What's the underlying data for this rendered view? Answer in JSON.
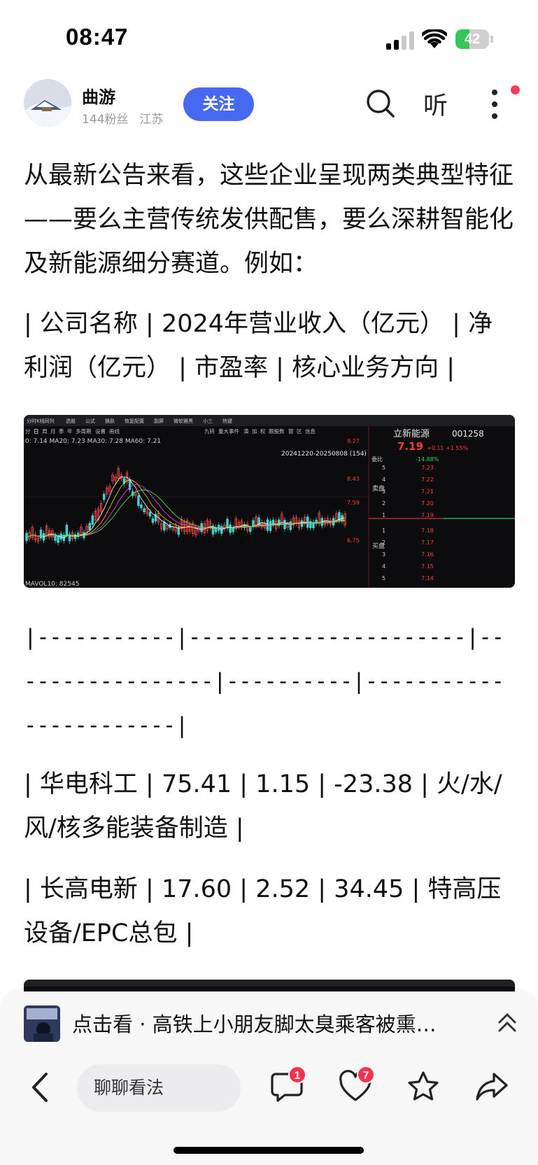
{
  "status_bar": {
    "time": "08:47",
    "battery_level": "42",
    "battery_fill_fraction": 0.42
  },
  "author": {
    "name": "曲游",
    "followers": "144粉丝",
    "location": "江苏",
    "follow_label": "关注",
    "listen_label": "听"
  },
  "article": {
    "paragraphs": [
      "从最新公告来看，这些企业呈现两类典型特征——要么主营传统发供配售，要么深耕智能化及新能源细分赛道。例如：",
      "| 公司名称 | 2024年营业收入（亿元） | 净利润（亿元） | 市盈率 | 核心业务方向 |",
      "|-----------|----------------------|-----------------|----------|-----------------------|",
      "| 华电科工 | 75.41 | 1.15 | -23.38 | 火/水/风/核多能装备制造 |",
      "| 长高电新 | 17.60 | 2.52 | 34.45 | 特高压设备/EPC总包 |"
    ],
    "chart_image": {
      "stock_name": "立新能源",
      "stock_code": "001258",
      "price": "7.19",
      "change": "+0.11",
      "change_pct": "+1.55%",
      "ma_line": "0: 7.14  MA20: 7.23  MA30: 7.28  MA60: 7.21",
      "range_label": "20241220-20250808 (154)",
      "axis_labels": [
        "9.27",
        "8.43",
        "7.59",
        "6.75"
      ],
      "vol_label": "MAVOL10: 82545",
      "order_book_header": "委比",
      "order_book_ratio": "-14.88%",
      "sell_label": "卖盘",
      "buy_label": "买盘",
      "order_rows": [
        {
          "level": "5",
          "price": "7.23"
        },
        {
          "level": "4",
          "price": "7.22"
        },
        {
          "level": "3",
          "price": "7.21"
        },
        {
          "level": "2",
          "price": "7.20"
        },
        {
          "level": "1",
          "price": "7.19"
        },
        {
          "level": "1",
          "price": "7.18"
        },
        {
          "level": "2",
          "price": "7.17"
        },
        {
          "level": "3",
          "price": "7.16"
        },
        {
          "level": "4",
          "price": "7.15"
        },
        {
          "level": "5",
          "price": "7.14"
        }
      ],
      "toolbar_items": [
        "分时K线同列",
        "选股",
        "公式",
        "换肤",
        "恢复配置",
        "副屏",
        "微软雅黑",
        "小三",
        "热键"
      ],
      "period_tabs": [
        "分",
        "日",
        "周",
        "月",
        "季",
        "年",
        "多周期",
        "设置",
        "画线"
      ],
      "toolbar_items_right": [
        "九转",
        "重大事件",
        "演",
        "加",
        "权",
        "跟股数",
        "窗",
        "区",
        "信息"
      ]
    }
  },
  "recommendation": {
    "text": "点击看 · 高铁上小朋友脚太臭乘客被熏…"
  },
  "toolbar": {
    "comment_placeholder": "聊聊看法",
    "comment_count": "1",
    "like_count": "7"
  },
  "colors": {
    "follow_button": "#4768f0",
    "badge": "#f5334f",
    "battery": "#35c759"
  }
}
